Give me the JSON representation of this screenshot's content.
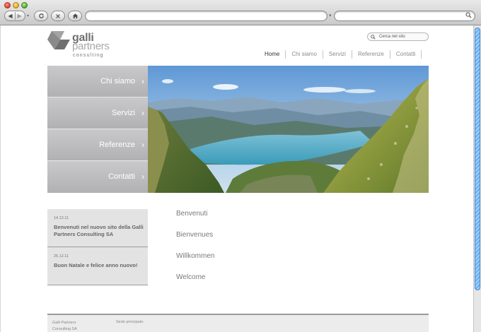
{
  "browser": {
    "icons": [
      "back-icon",
      "forward-icon",
      "reload-icon",
      "stop-icon",
      "home-icon",
      "search-icon"
    ],
    "url": "",
    "search_query": ""
  },
  "site": {
    "logo": {
      "word1": "galli",
      "word2": "partners",
      "word3": "consulting"
    },
    "search": {
      "placeholder": "Cerca nel sito"
    },
    "menu": [
      "Home",
      "Chi siamo",
      "Servizi",
      "Referenze",
      "Contatti"
    ],
    "active_menu": "Home",
    "sidenav": [
      "Chi siamo",
      "Servizi",
      "Referenze",
      "Contatti"
    ],
    "news": [
      {
        "date": "14.12.11",
        "title": "Benvenuti nel nuovo sito della Galli Partners Consulting SA"
      },
      {
        "date": "25.12.11",
        "title": "Buon Natale e felice anno nuovo!"
      }
    ],
    "welcome": [
      "Benvenuti",
      "Bienvenues",
      "Willkommen",
      "Welcome"
    ],
    "footer": {
      "company": "Galli Partners Consulting SA",
      "sede": "Sede principale:"
    }
  },
  "colors": {
    "sidenav": "#b9b9bc",
    "news_bg": "#e3e3e3",
    "accent_scroll": "#6aaef0"
  }
}
